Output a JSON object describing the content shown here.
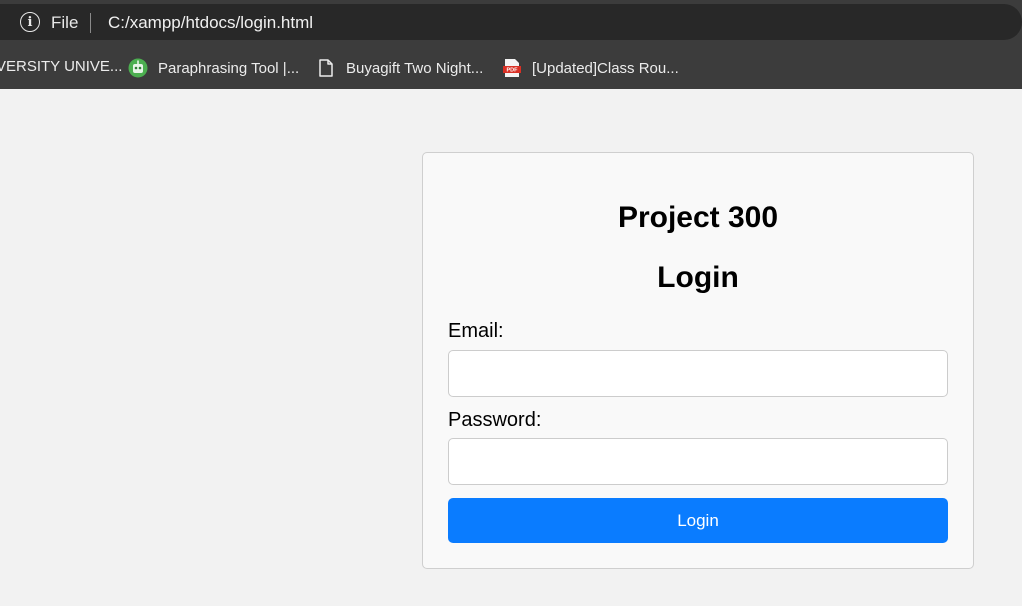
{
  "browser": {
    "scheme_label": "File",
    "url": "C:/xampp/htdocs/login.html",
    "bookmarks": [
      {
        "label": "VERSITY UNIVE...",
        "icon": "none"
      },
      {
        "label": "Paraphrasing Tool |...",
        "icon": "paraphrasing-tool-icon"
      },
      {
        "label": "Buyagift Two Night...",
        "icon": "document-icon"
      },
      {
        "label": "[Updated]Class Rou...",
        "icon": "pdf-icon"
      }
    ]
  },
  "login_form": {
    "project_title": "Project 300",
    "heading": "Login",
    "email_label": "Email:",
    "email_value": "",
    "password_label": "Password:",
    "password_value": "",
    "submit_label": "Login"
  }
}
